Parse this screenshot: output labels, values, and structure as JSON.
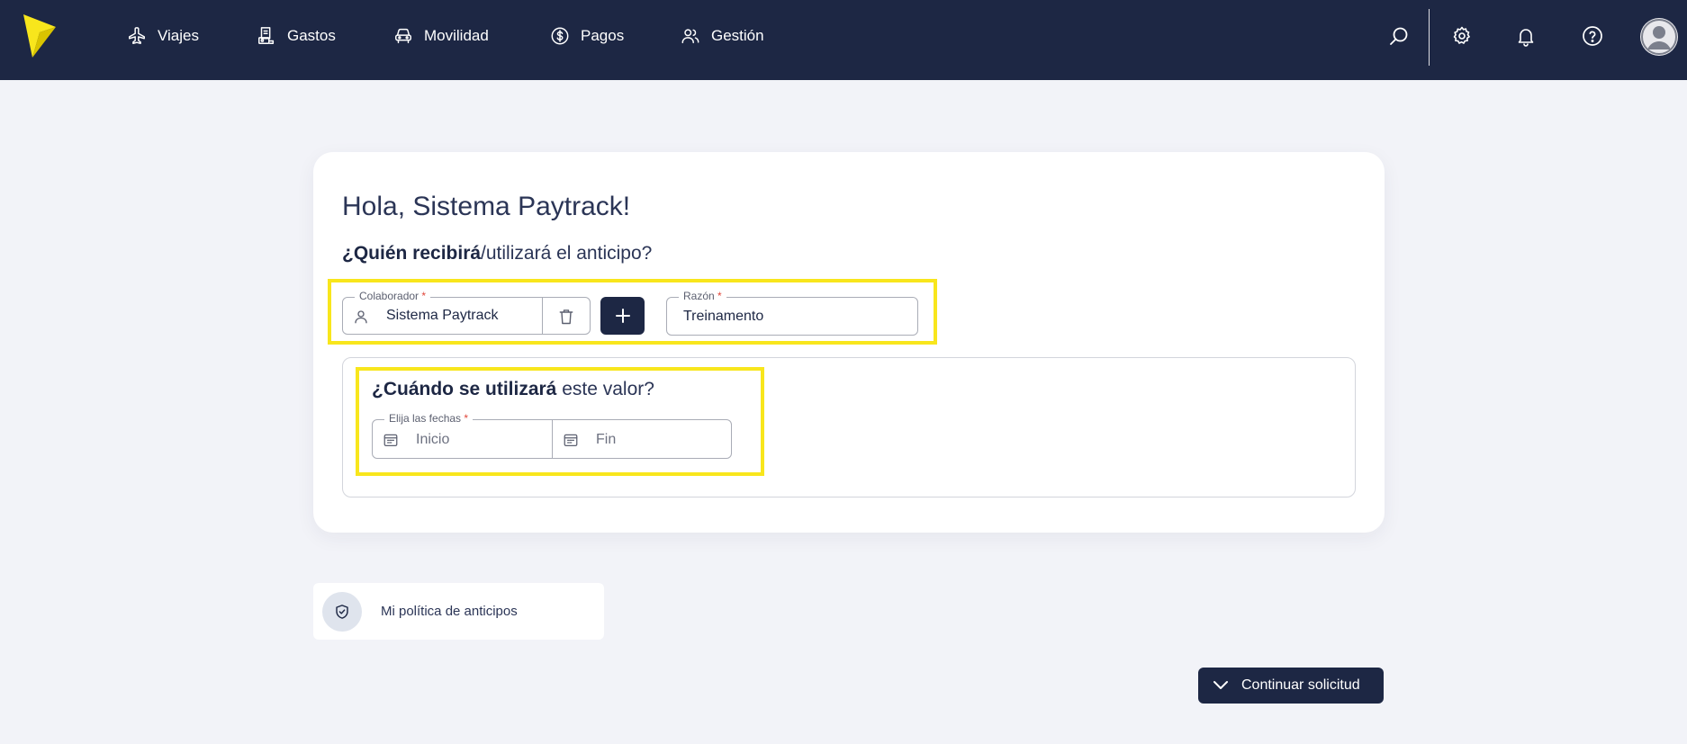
{
  "nav": {
    "items": [
      {
        "label": "Viajes",
        "icon": "airplane-icon"
      },
      {
        "label": "Gastos",
        "icon": "receipt-icon"
      },
      {
        "label": "Movilidad",
        "icon": "car-icon"
      },
      {
        "label": "Pagos",
        "icon": "dollar-circle-icon"
      },
      {
        "label": "Gestión",
        "icon": "users-icon"
      }
    ],
    "right_icons": [
      "search-icon",
      "gear-icon",
      "bell-icon",
      "help-icon",
      "avatar"
    ]
  },
  "main": {
    "greeting": "Hola, Sistema Paytrack!",
    "who": {
      "question_bold": "¿Quién recibirá",
      "question_rest": "/utilizará el anticipo?",
      "collaborator": {
        "label": "Colaborador",
        "required_mark": "*",
        "value": "Sistema Paytrack"
      },
      "reason": {
        "label": "Razón",
        "required_mark": "*",
        "value": "Treinamento"
      }
    },
    "when": {
      "question_bold": "¿Cuándo se utilizará",
      "question_rest": " este valor?",
      "dates_label": "Elija las fechas",
      "required_mark": "*",
      "start_placeholder": "Inicio",
      "end_placeholder": "Fin"
    }
  },
  "policy": {
    "label": "Mi política de anticipos"
  },
  "actions": {
    "continue_label": "Continuar solicitud"
  },
  "colors": {
    "navbar": "#1d2744",
    "highlight": "#f8e61c",
    "background": "#f2f3f8",
    "required": "#e0463a"
  }
}
